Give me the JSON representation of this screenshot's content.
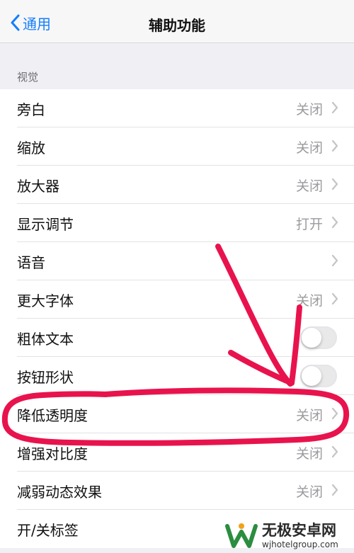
{
  "nav": {
    "back_label": "通用",
    "title": "辅助功能"
  },
  "section": {
    "header": "视觉"
  },
  "rows": [
    {
      "label": "旁白",
      "value": "关闭"
    },
    {
      "label": "缩放",
      "value": "关闭"
    },
    {
      "label": "放大器",
      "value": "关闭"
    },
    {
      "label": "显示调节",
      "value": "打开"
    },
    {
      "label": "语音",
      "value": ""
    },
    {
      "label": "更大字体",
      "value": "关闭"
    },
    {
      "label": "粗体文本",
      "toggle": false
    },
    {
      "label": "按钮形状",
      "toggle": false
    },
    {
      "label": "降低透明度",
      "value": "关闭"
    },
    {
      "label": "增强对比度",
      "value": "关闭"
    },
    {
      "label": "减弱动态效果",
      "value": "关闭"
    },
    {
      "label": "开/关标签",
      "value": ""
    }
  ],
  "annotation_color": "#e8134d",
  "accent_color": "#147efb",
  "watermark": {
    "name": "无极安卓网",
    "url": "wjhotelgroup.com"
  }
}
